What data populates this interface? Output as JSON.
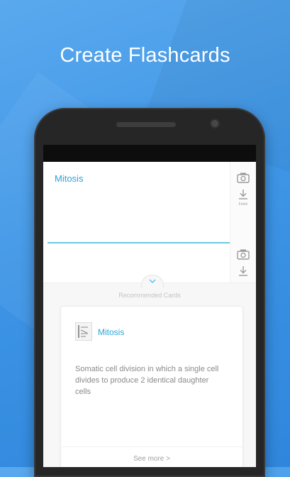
{
  "headline": "Create Flashcards",
  "editor": {
    "term": "Mitosis",
    "tools": [
      {
        "icon": "camera-icon",
        "caption": ""
      },
      {
        "icon": "download-icon",
        "caption": "Fetch"
      }
    ],
    "definition_tools": [
      {
        "icon": "camera-icon"
      },
      {
        "icon": "download-icon"
      }
    ]
  },
  "recommended": {
    "label": "Recommended Cards",
    "expand_icon": "chevron-down-icon",
    "card": {
      "thumbnail": "diagram-thumbnail-icon",
      "title": "Mitosis",
      "definition": "Somatic cell division in which a single cell divides to produce 2 identical daughter cells",
      "see_more": "See more >"
    }
  },
  "colors": {
    "accent": "#2aa5d6",
    "background": "#3f96e6"
  }
}
